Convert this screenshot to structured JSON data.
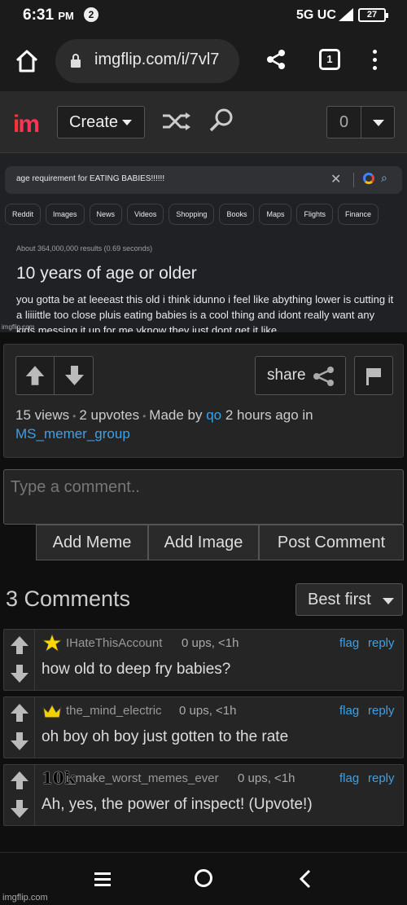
{
  "status": {
    "time": "6:31",
    "ampm": "PM",
    "notif_count": "2",
    "network": "5G UC",
    "battery": "27"
  },
  "browser": {
    "url": "imgflip.com/i/7vl7"
  },
  "header": {
    "create_label": "Create",
    "notif_count": "0"
  },
  "meme_image": {
    "query": "age requirement for EATING BABIES!!!!!!",
    "tabs": [
      "Reddit",
      "Images",
      "News",
      "Videos",
      "Shopping",
      "Books",
      "Maps",
      "Flights",
      "Finance"
    ],
    "stats": "About 364,000,000 results (0.69 seconds)",
    "answer": "10 years of age or older",
    "body": "you gotta be at leeeast this old i think idunno i feel like abything lower is cutting it a liiiittle too close pluis eating babies is a cool thing and idont really want any kids messing it up for me yknow they just dont get it like",
    "watermark": "imgflip.com"
  },
  "meme_meta": {
    "share_label": "share",
    "views": "15 views",
    "upvotes": "2 upvotes",
    "made_by_prefix": "Made by",
    "author": "qo",
    "time_in": "2 hours ago in",
    "stream": "MS_memer_group"
  },
  "comment_form": {
    "placeholder": "Type a comment..",
    "add_meme": "Add Meme",
    "add_image": "Add Image",
    "post_comment": "Post Comment"
  },
  "comments_header": {
    "count_label": "3 Comments",
    "sort_label": "Best first"
  },
  "comments": [
    {
      "user": "IHateThisAccount",
      "stats": "0 ups, <1h",
      "text": "how old to deep fry babies?",
      "flag": "flag",
      "reply": "reply",
      "badge": "star-badge-icon"
    },
    {
      "user": "the_mind_electric",
      "stats": "0 ups, <1h",
      "text": "oh boy oh boy just gotten to the rate",
      "flag": "flag",
      "reply": "reply",
      "badge": "crown-badge-icon"
    },
    {
      "user": "i_make_worst_memes_ever",
      "stats": "0 ups, <1h",
      "text": "Ah, yes, the power of inspect! (Upvote!)",
      "flag": "flag",
      "reply": "reply",
      "badge_text": "10k"
    }
  ],
  "footer": {
    "watermark": "imgflip.com"
  },
  "colors": {
    "link": "#3fa0e6",
    "bg": "#0f0f0f",
    "panel": "#252525",
    "logo": "#ff3355"
  }
}
